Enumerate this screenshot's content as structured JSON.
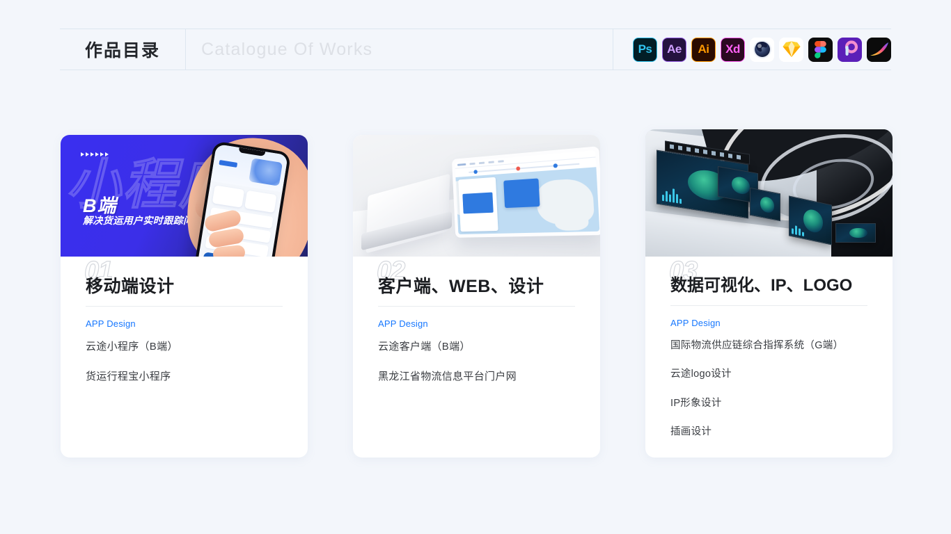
{
  "page": {
    "background_color": "#f3f6fb"
  },
  "header": {
    "title_cn": "作品目录",
    "title_en": "Catalogue Of Works",
    "tools": [
      {
        "name": "photoshop-icon",
        "label": "Ps"
      },
      {
        "name": "after-effects-icon",
        "label": "Ae"
      },
      {
        "name": "illustrator-icon",
        "label": "Ai"
      },
      {
        "name": "adobe-xd-icon",
        "label": "Xd"
      },
      {
        "name": "cinema-4d-icon",
        "label": ""
      },
      {
        "name": "sketch-icon",
        "label": ""
      },
      {
        "name": "figma-icon",
        "label": ""
      },
      {
        "name": "principle-icon",
        "label": ""
      },
      {
        "name": "procreate-icon",
        "label": ""
      }
    ]
  },
  "cards": [
    {
      "index": "01",
      "title": "移动端设计",
      "subtitle": "APP Design",
      "items": [
        "云途小程序（B端）",
        "货运行程宝小程序"
      ],
      "media": {
        "type": "mini-program-banner",
        "headline": "B端",
        "tagline": "解决货运用户实时跟踪问题",
        "watermark": "小程序",
        "accent": "#3a2ff0"
      }
    },
    {
      "index": "02",
      "title": "客户端、WEB、设计",
      "subtitle": "APP Design",
      "items": [
        "云途客户端（B端）",
        "黑龙江省物流信息平台门户网"
      ],
      "media": {
        "type": "laptop-mockup",
        "accent": "#2f7ae0"
      }
    },
    {
      "index": "03",
      "title": "数据可视化、IP、LOGO",
      "subtitle": "APP Design",
      "items": [
        "国际物流供应链综合指挥系统（G端）",
        "云途logo设计",
        "IP形象设计",
        "插画设计"
      ],
      "media": {
        "type": "control-room-photo",
        "accent": "#1f9f86"
      }
    }
  ]
}
